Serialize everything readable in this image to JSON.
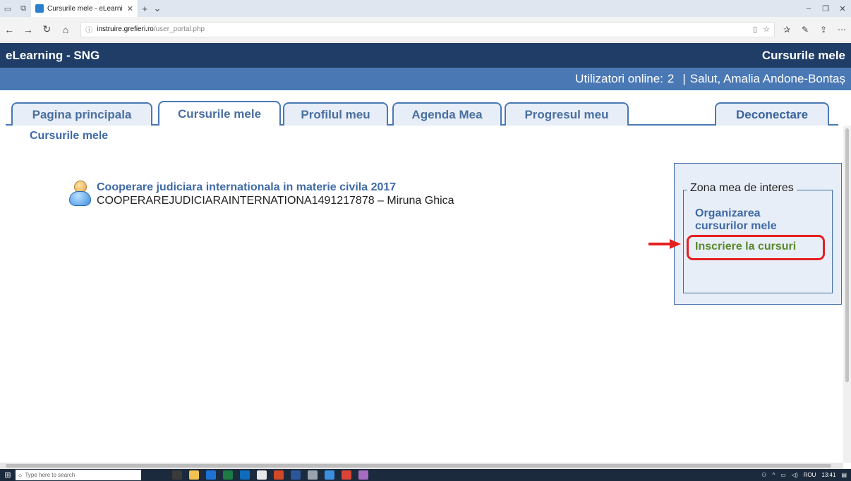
{
  "browser": {
    "tab_title": "Cursurile mele - eLearni",
    "url_domain": "instruire.grefieri.ro",
    "url_path": "/user_portal.php"
  },
  "app": {
    "title": "eLearning - SNG",
    "section": "Cursurile mele",
    "online_label": "Utilizatori online:",
    "online_count": "2",
    "separator": "|",
    "greeting": "Salut, Amalia Andone-Bontaș"
  },
  "tabs": {
    "home": "Pagina principala",
    "my_courses": "Cursurile mele",
    "profile": "Profilul meu",
    "agenda": "Agenda Mea",
    "progress": "Progresul meu",
    "logout": "Deconectare"
  },
  "breadcrumb": "Cursurile mele",
  "course": {
    "title": "Cooperare judiciara internationala in materie civila 2017",
    "code_and_teacher": "COOPERAREJUDICIARAINTERNATIONA1491217878 – Miruna Ghica"
  },
  "interest": {
    "legend": "Zona mea de interes",
    "organize_line1": "Organizarea",
    "organize_line2": "cursurilor mele",
    "enroll": "Inscriere la cursuri"
  },
  "taskbar": {
    "search_placeholder": "Type here to search",
    "language": "ROU",
    "time": "13:41"
  },
  "colors": {
    "header_dark": "#1f3d66",
    "header_blue": "#4a78b5",
    "link_blue": "#3f6aa6",
    "link_green": "#5a8a2a",
    "highlight_red": "#e52020"
  }
}
